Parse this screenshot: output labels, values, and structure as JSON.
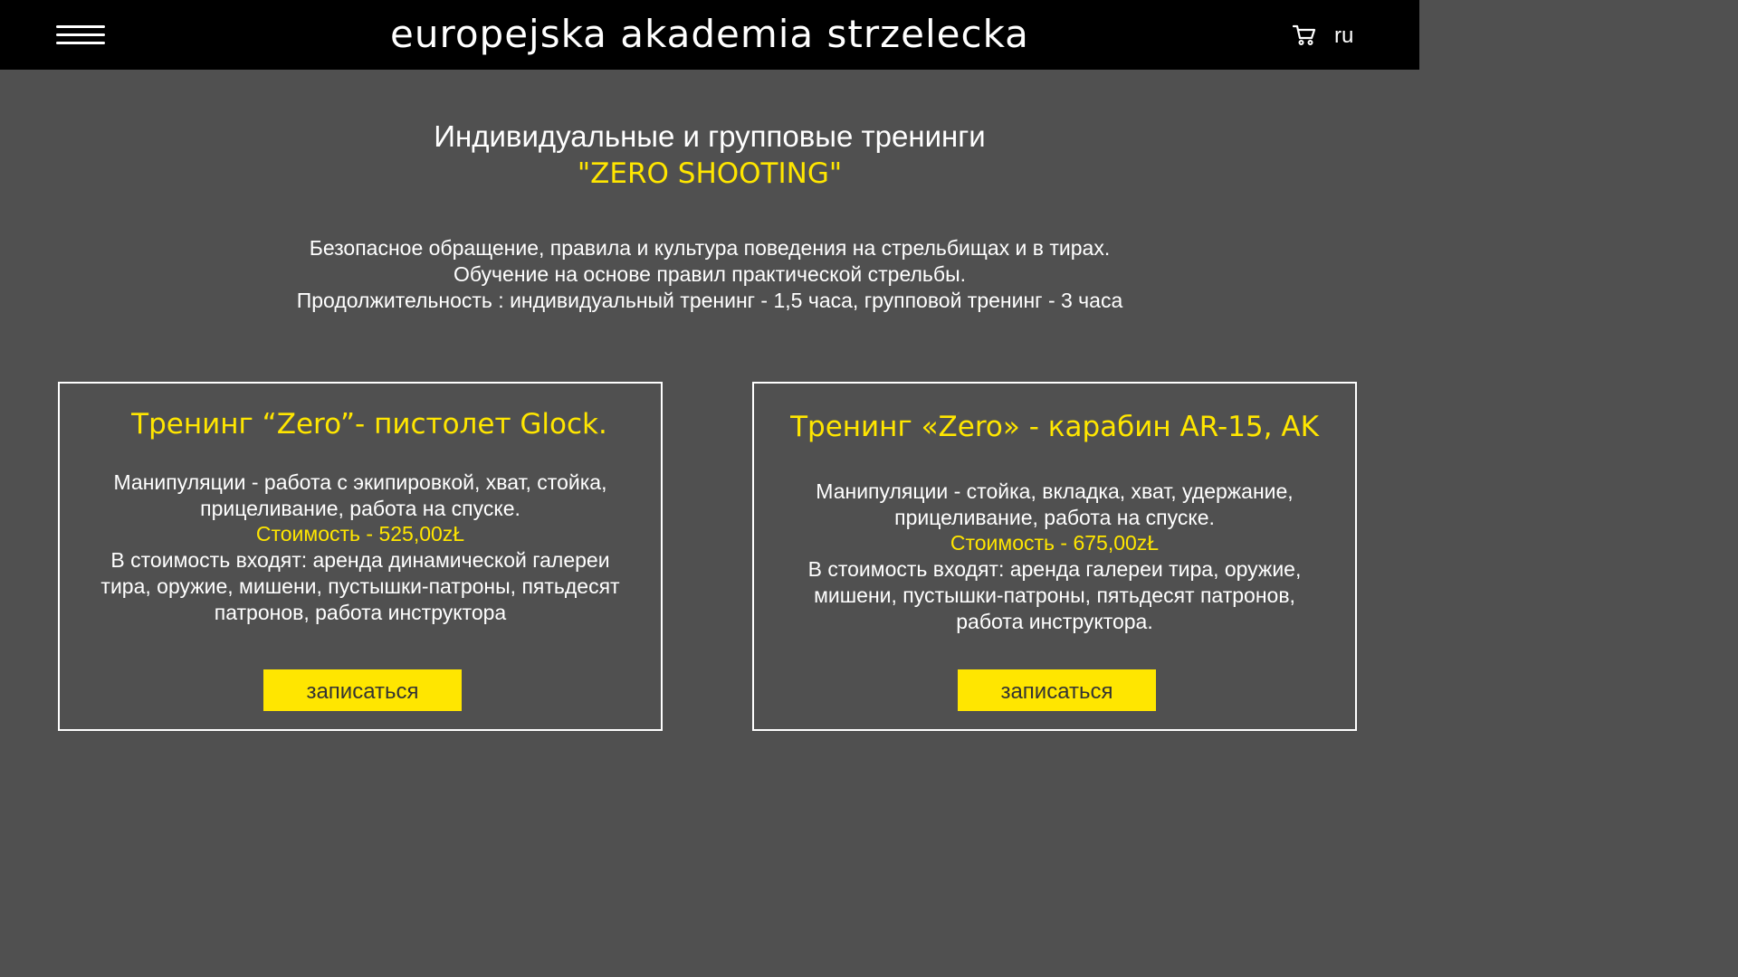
{
  "header": {
    "logo_text": "europejska akademia strzelecka",
    "language": "ru",
    "icons": {
      "menu": "hamburger-menu-icon",
      "cart": "shopping-cart-icon"
    }
  },
  "hero": {
    "title": "Индивидуальные и групповые тренинги",
    "subtitle": "\"ZERO SHOOTING\""
  },
  "intro": {
    "lines": [
      "Безопасное обращение, правила и культура поведения на стрельбищах и в тирах.",
      "Обучение на основе правил практической стрельбы.",
      "Продолжительность : индивидуальный тренинг - 1,5 часа, групповой тренинг - 3 часа"
    ]
  },
  "cards": [
    {
      "title": "Тренинг “Zero”- пистолет Glock.",
      "manipulation_lines": [
        "Манипуляции - работа с экипировкой, хват, стойка,",
        "прицеливание, работа на спуске."
      ],
      "price": "Стоимость - 525,00zŁ",
      "includes_lines": [
        "В стоимость входят: аренда динамической галереи",
        "тира, оружие, мишени, пустышки-патроны, пятьдесят",
        "патронов, работа инструктора"
      ],
      "button_label": "записаться"
    },
    {
      "title": "Тренинг «Zero» - карабин AR-15, AK",
      "manipulation_lines": [
        "Манипуляции - стойка, вкладка, хват, удержание,",
        "прицеливание, работа на спуске."
      ],
      "price": "Стоимость - 675,00zŁ",
      "includes_lines": [
        "В стоимость входят: аренда галереи тира, оружие,",
        "мишени, пустышки-патроны, пятьдесят патронов,",
        "работа инструктора."
      ],
      "button_label": "записаться"
    }
  ],
  "colors": {
    "background": "#505050",
    "header": "#000000",
    "accent": "#ffe600",
    "text": "#ffffff",
    "button_text": "#333333"
  }
}
